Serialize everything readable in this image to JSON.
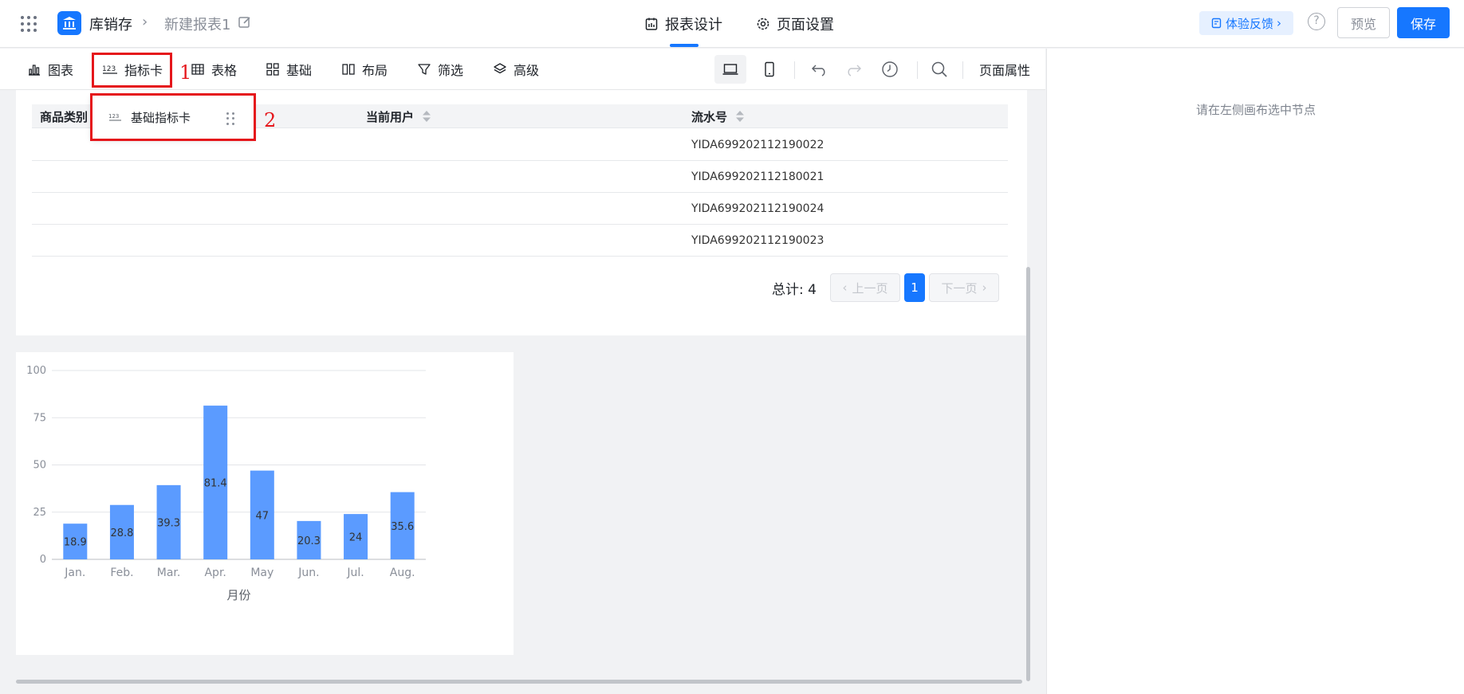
{
  "header": {
    "app_name": "库销存",
    "breadcrumb_sep": "›",
    "report_name": "新建报表1",
    "tabs": [
      {
        "label": "报表设计",
        "icon": "calendar-icon",
        "active": true
      },
      {
        "label": "页面设置",
        "icon": "gear-icon",
        "active": false
      }
    ],
    "feedback_label": "体验反馈",
    "help_label": "?",
    "preview_label": "预览",
    "save_label": "保存",
    "accent_color": "#1677ff"
  },
  "toolbar": {
    "items": [
      {
        "label": "图表",
        "icon": "bar-chart-icon"
      },
      {
        "label": "指标卡",
        "icon": "number-card-icon"
      },
      {
        "label": "表格",
        "icon": "table-icon"
      },
      {
        "label": "基础",
        "icon": "grid-icon"
      },
      {
        "label": "布局",
        "icon": "layout-icon"
      },
      {
        "label": "筛选",
        "icon": "filter-icon"
      },
      {
        "label": "高级",
        "icon": "layers-icon"
      }
    ],
    "page_props_label": "页面属性"
  },
  "annotations": {
    "marker_1": "1",
    "marker_2": "2",
    "highlight_color": "#e5161b"
  },
  "popup": {
    "item_label": "基础指标卡"
  },
  "table": {
    "columns": [
      "商品类别",
      "当前用户",
      "流水号"
    ],
    "rows": [
      {
        "category": "",
        "user": "",
        "serial": "YIDA699202112190022"
      },
      {
        "category": "",
        "user": "",
        "serial": "YIDA699202112180021"
      },
      {
        "category": "",
        "user": "",
        "serial": "YIDA699202112190024"
      },
      {
        "category": "",
        "user": "",
        "serial": "YIDA699202112190023"
      }
    ],
    "total_label": "总计: 4",
    "prev_label": "上一页",
    "current_page": "1",
    "next_label": "下一页"
  },
  "chart_data": {
    "type": "bar",
    "categories": [
      "Jan.",
      "Feb.",
      "Mar.",
      "Apr.",
      "May",
      "Jun.",
      "Jul.",
      "Aug."
    ],
    "values": [
      18.9,
      28.8,
      39.3,
      81.4,
      47,
      20.3,
      24,
      35.6
    ],
    "data_labels": [
      "18.9",
      "28.8",
      "39.3",
      "81.4",
      "47",
      "20.3",
      "24",
      "35.6"
    ],
    "title": "",
    "xlabel": "月份",
    "ylabel": "",
    "ylim": [
      0,
      100
    ],
    "yticks": [
      "0",
      "25",
      "50",
      "75",
      "100"
    ],
    "grid": true,
    "bar_color": "#5b9bff"
  },
  "right_panel": {
    "hint": "请在左侧画布选中节点"
  }
}
